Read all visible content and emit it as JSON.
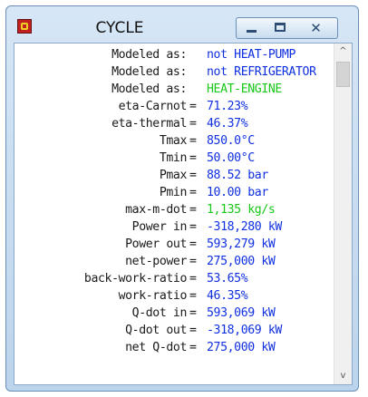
{
  "window": {
    "title": "CYCLE",
    "app_icon": "app-icon",
    "controls": {
      "minimize": "minimize-icon",
      "maximize": "maximize-icon",
      "close": "close-icon"
    },
    "close_glyph": "✕"
  },
  "colors": {
    "label": "#1a1a1a",
    "value_blue": "#1030e0",
    "value_green": "#18c818"
  },
  "lines": [
    {
      "label": "Modeled as:",
      "eq": "",
      "value": "not HEAT-PUMP",
      "color": "blue"
    },
    {
      "label": "Modeled as:",
      "eq": "",
      "value": "not REFRIGERATOR",
      "color": "blue"
    },
    {
      "label": "Modeled as:",
      "eq": "",
      "value": "HEAT-ENGINE",
      "color": "green"
    },
    {
      "label": "eta-Carnot",
      "eq": "=",
      "value": "71.23%",
      "color": "blue"
    },
    {
      "label": "eta-thermal",
      "eq": "=",
      "value": "46.37%",
      "color": "blue"
    },
    {
      "label": "Tmax",
      "eq": "=",
      "value": "850.0°C",
      "color": "blue"
    },
    {
      "label": "Tmin",
      "eq": "=",
      "value": "50.00°C",
      "color": "blue"
    },
    {
      "label": "Pmax",
      "eq": "=",
      "value": "88.52 bar",
      "color": "blue"
    },
    {
      "label": "Pmin",
      "eq": "=",
      "value": "10.00 bar",
      "color": "blue"
    },
    {
      "label": "max-m-dot",
      "eq": "=",
      "value": "1,135 kg/s",
      "color": "green"
    },
    {
      "label": "Power in",
      "eq": "=",
      "value": "-318,280 kW",
      "color": "blue"
    },
    {
      "label": "Power out",
      "eq": "=",
      "value": "593,279 kW",
      "color": "blue"
    },
    {
      "label": "net-power",
      "eq": "=",
      "value": "275,000 kW",
      "color": "blue"
    },
    {
      "label": "back-work-ratio",
      "eq": "=",
      "value": "53.65%",
      "color": "blue"
    },
    {
      "label": "work-ratio",
      "eq": "=",
      "value": "46.35%",
      "color": "blue"
    },
    {
      "label": "Q-dot in",
      "eq": "=",
      "value": "593,069 kW",
      "color": "blue"
    },
    {
      "label": "Q-dot out",
      "eq": "=",
      "value": "-318,069 kW",
      "color": "blue"
    },
    {
      "label": "net Q-dot",
      "eq": "=",
      "value": "275,000 kW",
      "color": "blue"
    }
  ],
  "scrollbar": {
    "up_icon": "chevron-up-icon",
    "down_icon": "chevron-down-icon",
    "up_glyph": "^",
    "down_glyph": "v"
  }
}
